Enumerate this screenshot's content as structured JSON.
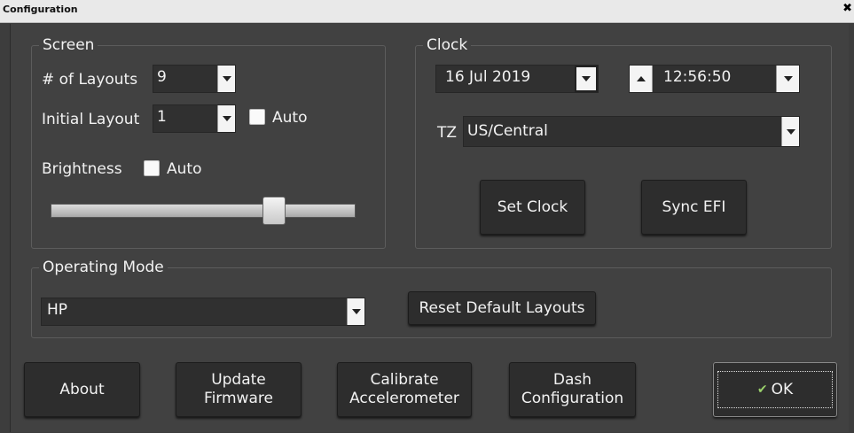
{
  "window": {
    "title": "Configuration",
    "close_icon": "close-icon"
  },
  "screen": {
    "legend": "Screen",
    "layouts_label": "# of Layouts",
    "layouts_value": "9",
    "initial_label": "Initial Layout",
    "initial_value": "1",
    "auto_label": "Auto",
    "auto_checked": false,
    "brightness_label": "Brightness",
    "brightness_auto_label": "Auto",
    "brightness_auto_checked": false,
    "brightness_level": 0.75
  },
  "clock": {
    "legend": "Clock",
    "date_value": "16 Jul 2019",
    "time_value": "12:56:50",
    "tz_label": "TZ",
    "tz_value": "US/Central",
    "set_clock_label": "Set Clock",
    "sync_efi_label": "Sync EFI"
  },
  "operating_mode": {
    "legend": "Operating Mode",
    "value": "HP",
    "reset_label": "Reset Default Layouts"
  },
  "footer": {
    "about_label": "About",
    "update_line1": "Update",
    "update_line2": "Firmware",
    "calibrate_line1": "Calibrate",
    "calibrate_line2": "Accelerometer",
    "dash_line1": "Dash",
    "dash_line2": "Configuration",
    "ok_label": "OK",
    "ok_icon": "check-icon"
  },
  "colors": {
    "background": "#414141",
    "control_bg": "#303030",
    "text": "#f2f2f2",
    "arrow_button": "#f4f4f4",
    "ok_icon": "#9ad06b"
  }
}
